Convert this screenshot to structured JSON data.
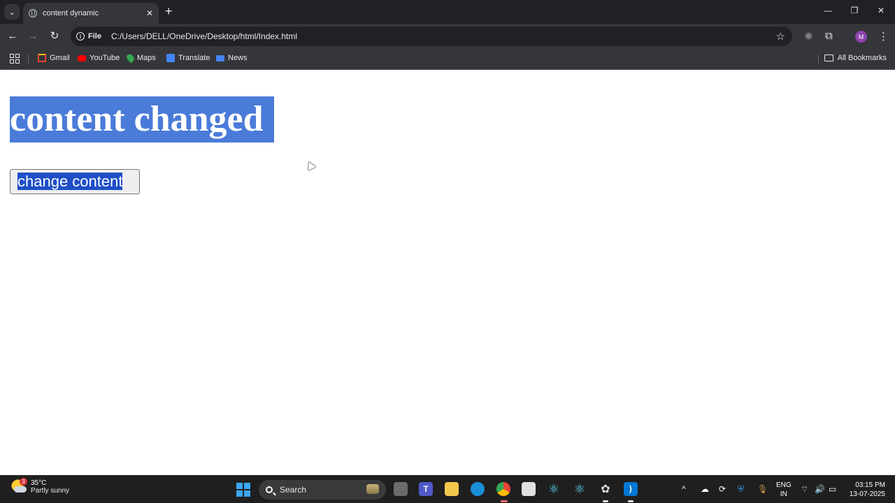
{
  "browser": {
    "tab_title": "content dynamic",
    "tab_close": "✕",
    "new_tab": "+",
    "address_scheme": "File",
    "address_url": "C:/Users/DELL/OneDrive/Desktop/html/Index.html",
    "profile_initial": "M",
    "window_controls": {
      "minimize": "—",
      "restore": "❐",
      "close": "✕"
    }
  },
  "bookmarks": {
    "items": [
      {
        "label": "Gmail",
        "icon": "gmail-icon",
        "color": "#ea4335"
      },
      {
        "label": "YouTube",
        "icon": "youtube-icon",
        "color": "#ff0000"
      },
      {
        "label": "Maps",
        "icon": "maps-icon",
        "color": "#34a853"
      },
      {
        "label": "Translate",
        "icon": "translate-icon",
        "color": "#4285f4"
      },
      {
        "label": "News",
        "icon": "news-icon",
        "color": "#4285f4"
      }
    ],
    "all_bookmarks": "All Bookmarks"
  },
  "page": {
    "heading": "content changed",
    "button_label": "change content"
  },
  "taskbar": {
    "weather_temp": "35°C",
    "weather_desc": "Partly sunny",
    "weather_badge": "3",
    "search_label": "Search",
    "lang_line1": "ENG",
    "lang_line2": "IN",
    "time": "03:15 PM",
    "date": "13-07-2025"
  },
  "colors": {
    "heading_selection": "#4a7bd9",
    "button_selection": "#1e4fc8",
    "chrome_dark": "#202124",
    "chrome_toolbar": "#35363a",
    "taskbar": "#1f1f1f"
  }
}
